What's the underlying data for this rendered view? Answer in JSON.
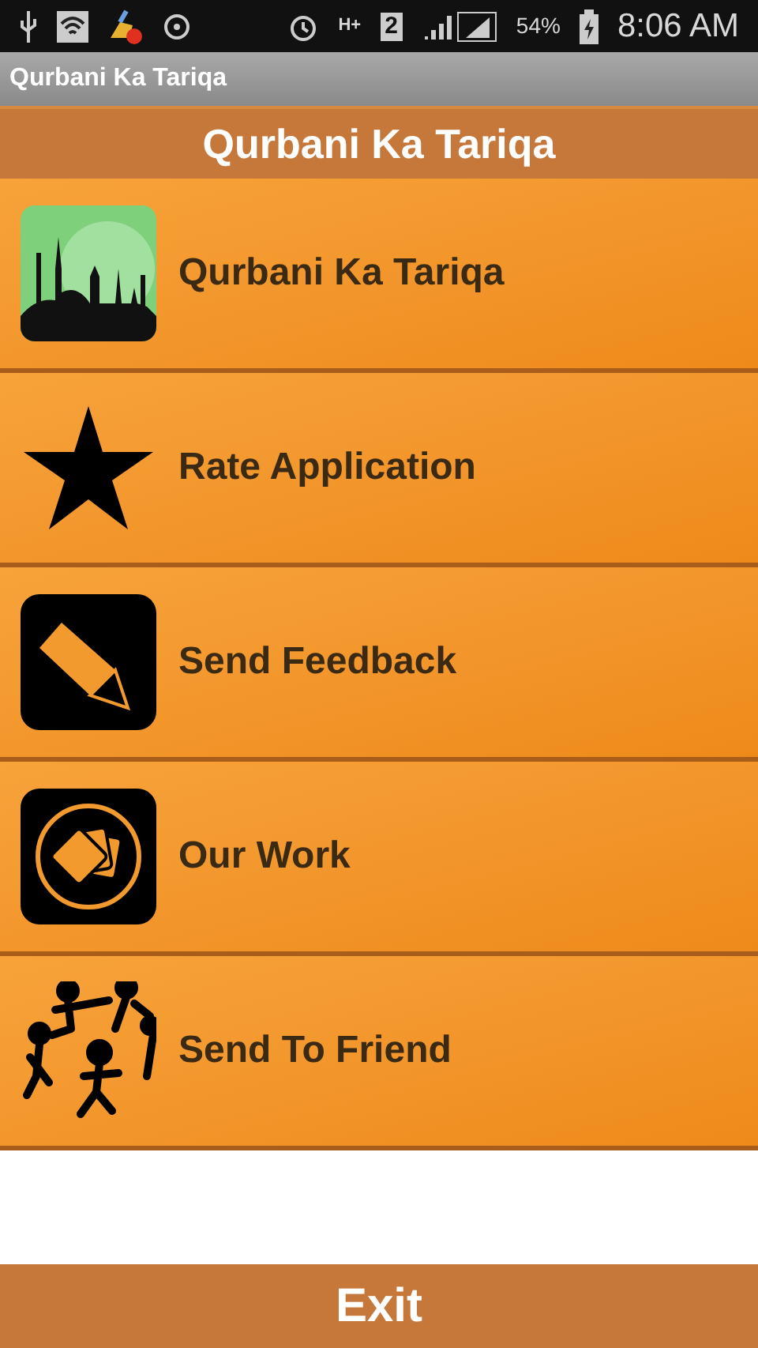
{
  "status_bar": {
    "network_type": "H+",
    "sim_slot": "2",
    "battery": "54%",
    "time": "8:06 AM"
  },
  "app_bar": {
    "title": "Qurbani Ka Tariqa"
  },
  "header": {
    "title": "Qurbani Ka Tariqa"
  },
  "menu": [
    {
      "label": "Qurbani Ka Tariqa",
      "kind": "picture"
    },
    {
      "label": "Rate Application",
      "kind": "star"
    },
    {
      "label": "Send Feedback",
      "kind": "pencil"
    },
    {
      "label": "Our Work",
      "kind": "cards"
    },
    {
      "label": "Send To Friend",
      "kind": "people"
    }
  ],
  "footer": {
    "button": "Exit"
  }
}
